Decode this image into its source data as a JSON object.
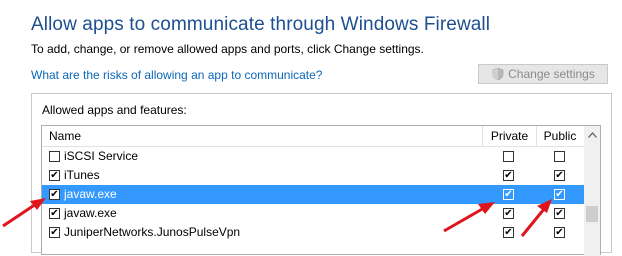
{
  "page": {
    "title": "Allow apps to communicate through Windows Firewall",
    "subtitle": "To add, change, or remove allowed apps and ports, click Change settings.",
    "risk_link": "What are the risks of allowing an app to communicate?",
    "change_settings_label": "Change settings"
  },
  "apps_group": {
    "label": "Allowed apps and features:",
    "columns": {
      "name": "Name",
      "private": "Private",
      "public": "Public"
    },
    "rows": [
      {
        "name": "iSCSI Service",
        "enabled": false,
        "private": false,
        "public": false
      },
      {
        "name": "iTunes",
        "enabled": true,
        "private": true,
        "public": true
      },
      {
        "name": "javaw.exe",
        "enabled": true,
        "private": true,
        "public": true,
        "selected": true
      },
      {
        "name": "javaw.exe",
        "enabled": true,
        "private": true,
        "public": true
      },
      {
        "name": "JuniperNetworks.JunosPulseVpn",
        "enabled": true,
        "private": true,
        "public": true
      }
    ]
  },
  "colors": {
    "title": "#1d4f91",
    "link": "#0b67b8",
    "selection": "#3399ff",
    "annotation_arrow": "#e0141c"
  }
}
